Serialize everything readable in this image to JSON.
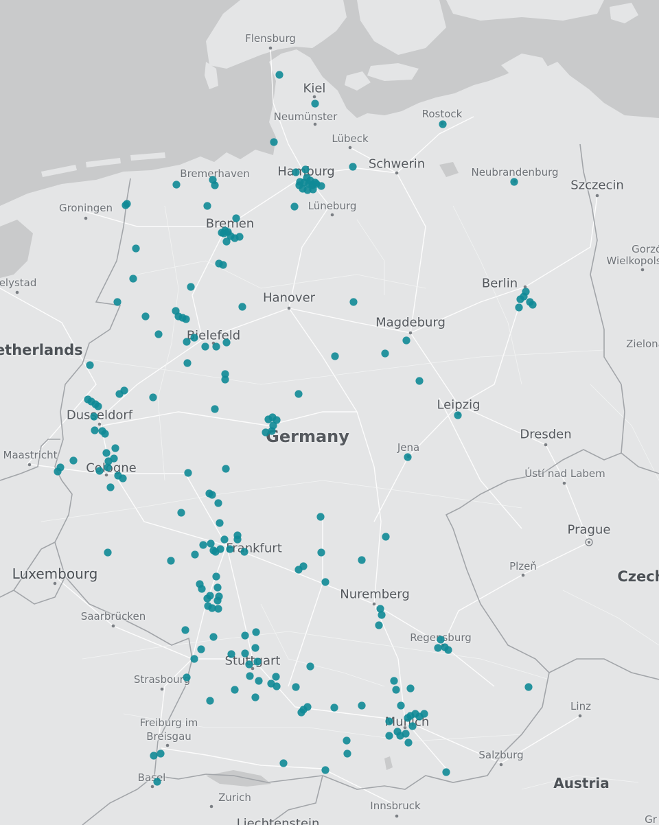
{
  "map": {
    "title": "",
    "colors": {
      "water": "#c9cacb",
      "land": "#e4e5e6",
      "border": "#a7a9ac",
      "roads": "#ffffff",
      "marker": "#0f8a96",
      "text": "#6f7378"
    }
  },
  "places": {
    "flensburg": "Flensburg",
    "kiel": "Kiel",
    "neumunster": "Neumünster",
    "rostock": "Rostock",
    "lubeck": "Lübeck",
    "schwerin": "Schwerin",
    "bremerhaven": "Bremerhaven",
    "hamburg": "Hamburg",
    "neubrandenburg": "Neubrandenburg",
    "szczecin": "Szczecin",
    "groningen": "Groningen",
    "luneburg": "Lüneburg",
    "bremen": "Bremen",
    "gorzow": "Gorzów\nWielkopolski",
    "lelystad": "Lelystad",
    "berlin": "Berlin",
    "hanover": "Hanover",
    "magdeburg": "Magdeburg",
    "bielefeld": "Bielefeld",
    "zielona": "Zielona",
    "netherlands": "Netherlands",
    "dusseldorf": "Dusseldorf",
    "leipzig": "Leipzig",
    "germany": "Germany",
    "dresden": "Dresden",
    "jena": "Jena",
    "maastricht": "Maastricht",
    "cologne": "Cologne",
    "usti": "Ústí nad Labem",
    "prague": "Prague",
    "frankfurt": "Frankfurt",
    "plzen": "Plzeň",
    "luxembourg": "Luxembourg",
    "czech": "Czech",
    "nuremberg": "Nuremberg",
    "saarbrucken": "Saarbrücken",
    "regensburg": "Regensburg",
    "stuttgart": "Stuttgart",
    "strasbourg": "Strasbourg",
    "linz": "Linz",
    "freiburg": "Freiburg im\nBreisgau",
    "munich": "Munich",
    "salzburg": "Salzburg",
    "basel": "Basel",
    "austria": "Austria",
    "zurich": "Zurich",
    "innsbruck": "Innsbruck",
    "liechtenstein": "Liechtenstein",
    "graz": "Gr"
  },
  "marker_count": "207"
}
